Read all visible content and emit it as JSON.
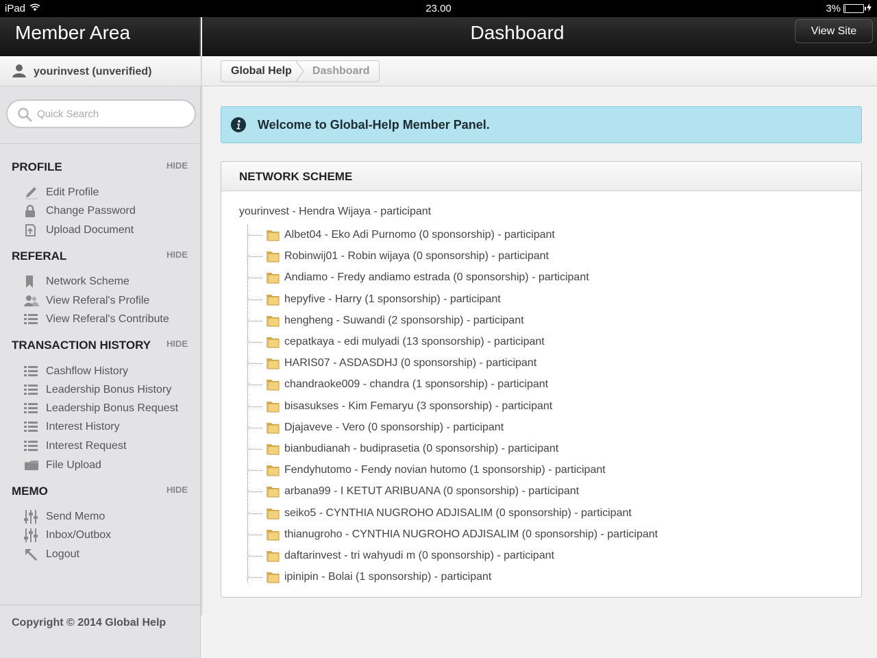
{
  "statusbar": {
    "device": "iPad",
    "time": "23.00",
    "battery_text": "3%",
    "battery_level": 0.03
  },
  "header": {
    "left_title": "Member Area",
    "main_title": "Dashboard",
    "view_site_label": "View Site"
  },
  "sidebar": {
    "user": "yourinvest (unverified)",
    "search_placeholder": "Quick Search",
    "hide_label": "HIDE",
    "sections": [
      {
        "title": "PROFILE",
        "items": [
          {
            "label": "Edit Profile",
            "icon": "pencil-icon"
          },
          {
            "label": "Change Password",
            "icon": "lock-icon"
          },
          {
            "label": "Upload Document",
            "icon": "upload-icon"
          }
        ]
      },
      {
        "title": "REFERAL",
        "items": [
          {
            "label": "Network Scheme",
            "icon": "bookmark-icon"
          },
          {
            "label": "View Referal's Profile",
            "icon": "users-icon"
          },
          {
            "label": "View Referal's Contribute",
            "icon": "list-icon"
          }
        ]
      },
      {
        "title": "TRANSACTION HISTORY",
        "items": [
          {
            "label": "Cashflow History",
            "icon": "list-icon"
          },
          {
            "label": "Leadership Bonus History",
            "icon": "list-icon"
          },
          {
            "label": "Leadership Bonus Request",
            "icon": "list-icon"
          },
          {
            "label": "Interest History",
            "icon": "list-icon"
          },
          {
            "label": "Interest Request",
            "icon": "list-icon"
          },
          {
            "label": "File Upload",
            "icon": "folder-icon"
          }
        ]
      },
      {
        "title": "MEMO",
        "items": [
          {
            "label": "Send Memo",
            "icon": "sliders-icon"
          },
          {
            "label": "Inbox/Outbox",
            "icon": "sliders-icon"
          },
          {
            "label": "Logout",
            "icon": "arrow-up-left-icon"
          }
        ]
      }
    ],
    "copyright": "Copyright © 2014 Global Help"
  },
  "breadcrumb": {
    "items": [
      "Global Help",
      "Dashboard"
    ]
  },
  "alert": {
    "text": "Welcome to Global-Help Member Panel."
  },
  "network": {
    "title": "NETWORK SCHEME",
    "root": "yourinvest - Hendra Wijaya - participant",
    "children": [
      "Albet04 - Eko Adi Purnomo (0 sponsorship) - participant",
      "Robinwij01 - Robin wijaya (0 sponsorship) - participant",
      "Andiamo - Fredy andiamo estrada (0 sponsorship) - participant",
      "hepyfive - Harry (1 sponsorship) - participant",
      "hengheng - Suwandi (2 sponsorship) - participant",
      "cepatkaya - edi mulyadi (13 sponsorship) - participant",
      "HARIS07 - ASDASDHJ (0 sponsorship) - participant",
      "chandraoke009 - chandra (1 sponsorship) - participant",
      "bisasukses - Kim Femaryu (3 sponsorship) - participant",
      "Djajaveve - Vero (0 sponsorship) - participant",
      "bianbudianah - budiprasetia (0 sponsorship) - participant",
      "Fendyhutomo - Fendy novian hutomo (1 sponsorship) - participant",
      "arbana99 - I KETUT ARIBUANA (0 sponsorship) - participant",
      "seiko5 - CYNTHIA NUGROHO ADJISALIM (0 sponsorship) - participant",
      "thianugroho - CYNTHIA NUGROHO ADJISALIM (0 sponsorship) - participant",
      "daftarinvest - tri wahyudi m (0 sponsorship) - participant",
      "ipinipin - Bolai (1 sponsorship) - participant"
    ]
  },
  "colors": {
    "header_dark": "#1a1a1a",
    "sidebar_bg": "#e3e3e6",
    "alert_bg": "#b3e3ef",
    "folder": "#e8c26a"
  }
}
